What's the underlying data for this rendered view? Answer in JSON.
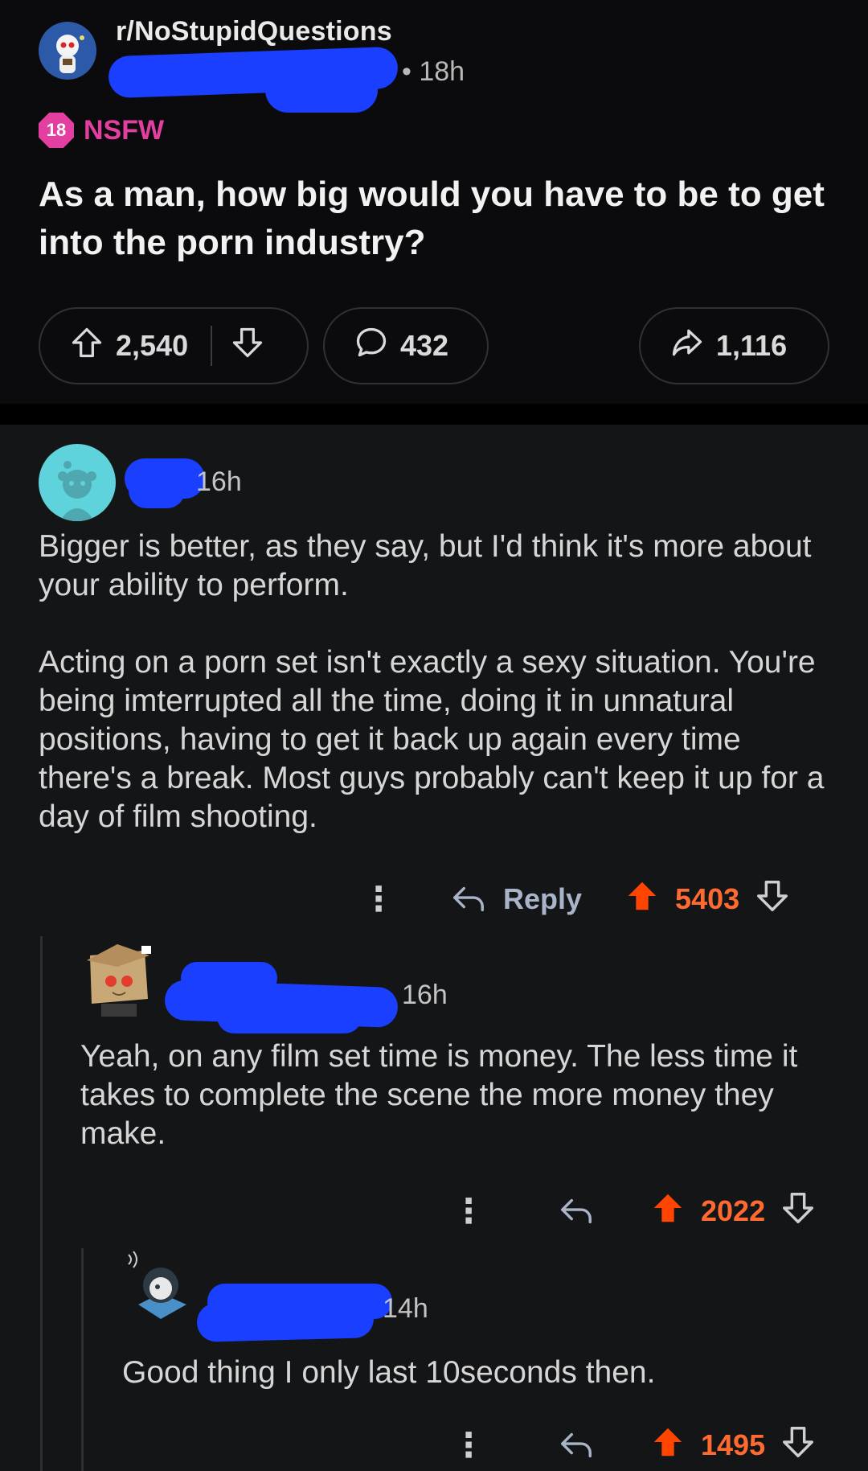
{
  "post": {
    "subreddit": "r/NoStupidQuestions",
    "time": "• 18h",
    "nsfw_badge": "18",
    "nsfw_label": "NSFW",
    "title": "As a man, how big would you have to be to get into the porn industry?",
    "upvotes": "2,540",
    "comments": "432",
    "shares": "1,116"
  },
  "comments": [
    {
      "time": "16h",
      "paragraphs": [
        "Bigger is better, as they say, but I'd think it's more about your ability to perform.",
        "Acting on a porn set isn't exactly a sexy situation. You're being imterrupted all the time, doing it in unnatural positions, having to get it back up again every time there's a break. Most guys probably can't keep it up for a day of film shooting."
      ],
      "reply_label": "Reply",
      "score": "5403"
    },
    {
      "time": "16h",
      "paragraphs": [
        "Yeah, on any film set time is money. The less time it takes to complete the scene the more money they make."
      ],
      "score": "2022"
    },
    {
      "time": "14h",
      "paragraphs": [
        "Good thing I only last 10seconds then."
      ],
      "score": "1495"
    }
  ],
  "colors": {
    "background": "#0b0b0d",
    "comments_bg": "#141517",
    "upvoted": "#ff6a30",
    "nsfw": "#e23fa0",
    "redaction": "#1a3fff"
  },
  "icons": [
    "upvote-icon",
    "downvote-icon",
    "comment-icon",
    "share-icon",
    "reply-icon",
    "more-icon"
  ]
}
